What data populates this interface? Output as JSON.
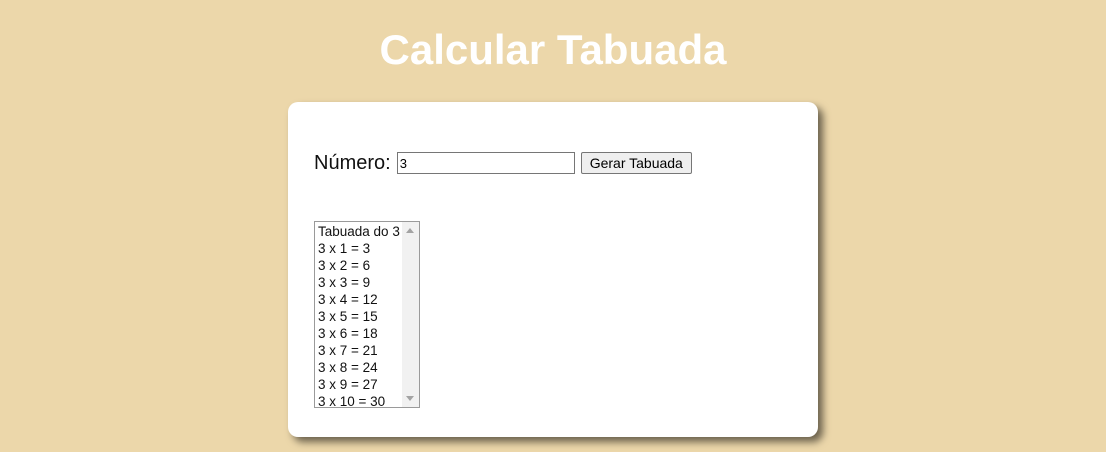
{
  "page": {
    "title": "Calcular Tabuada",
    "background_color": "#ecd7aa"
  },
  "form": {
    "number_label": "Número:",
    "number_value": "3",
    "generate_button_label": "Gerar Tabuada"
  },
  "result": {
    "options": [
      "Tabuada do 3",
      "3 x 1 = 3",
      "3 x 2 = 6",
      "3 x 3 = 9",
      "3 x 4 = 12",
      "3 x 5 = 15",
      "3 x 6 = 18",
      "3 x 7 = 21",
      "3 x 8 = 24",
      "3 x 9 = 27",
      "3 x 10 = 30"
    ]
  },
  "icons": {
    "scroll_up": "scroll-up-arrow-icon",
    "scroll_down": "scroll-down-arrow-icon"
  }
}
